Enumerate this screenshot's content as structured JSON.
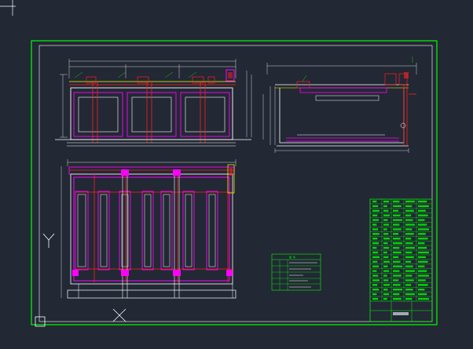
{
  "window": {
    "background": "#222834",
    "axis_y_label": "Y",
    "axis_x_label": "X"
  },
  "colors": {
    "frame": "#00ff00",
    "white_line": "#ffffff",
    "red": "#ff2020",
    "magenta": "#ff00ff",
    "yellow": "#ffff00",
    "cyan": "#00ffff",
    "green": "#00ff00"
  },
  "drawing": {
    "frame_outer": "green-outer-border",
    "frame_inner": "white-inner-border",
    "views": [
      "front-elevation",
      "side-elevation",
      "plan-view"
    ]
  },
  "legend": {
    "title": "图 例",
    "rows": 5
  },
  "title_block": {
    "rows": 22,
    "columns": 5
  },
  "ucs": {
    "icon": "ucs-crosshair-icon"
  }
}
